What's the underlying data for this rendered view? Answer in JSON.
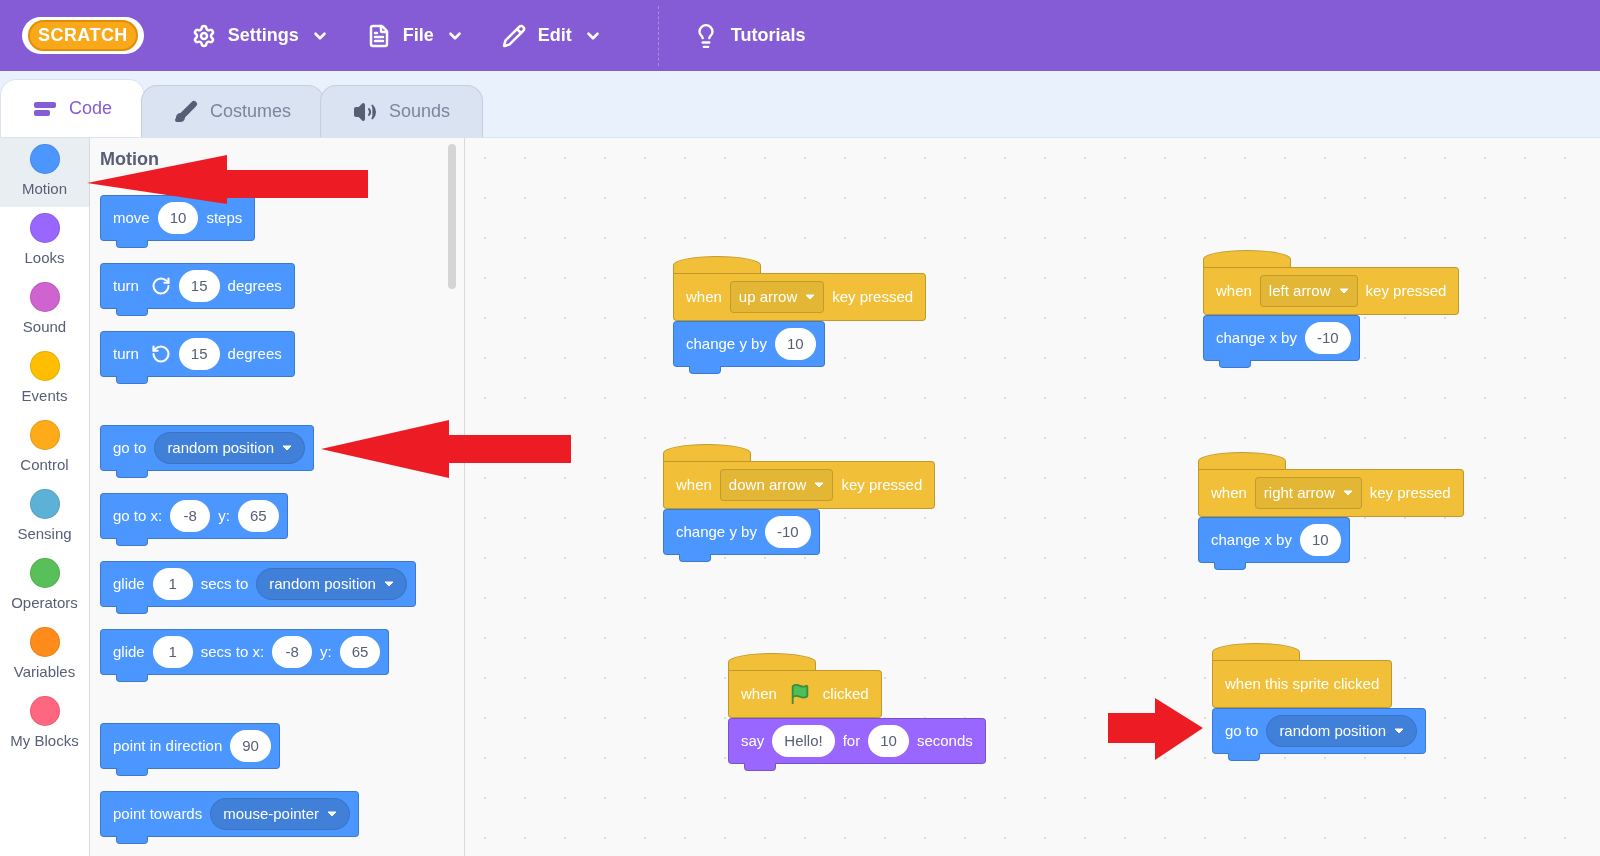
{
  "menu_bar": {
    "logo": "SCRATCH",
    "items": [
      {
        "label": "Settings",
        "kind": "gear"
      },
      {
        "label": "File",
        "kind": "file"
      },
      {
        "label": "Edit",
        "kind": "pencil"
      }
    ],
    "tutorials": "Tutorials"
  },
  "tabs": [
    {
      "label": "Code",
      "kind": "code",
      "selected": true
    },
    {
      "label": "Costumes",
      "kind": "brush",
      "selected": false
    },
    {
      "label": "Sounds",
      "kind": "speaker",
      "selected": false
    }
  ],
  "categories": [
    {
      "label": "Motion",
      "color": "#4c97ff",
      "selected": true
    },
    {
      "label": "Looks",
      "color": "#9966ff",
      "selected": false
    },
    {
      "label": "Sound",
      "color": "#cf63cf",
      "selected": false
    },
    {
      "label": "Events",
      "color": "#ffbf00",
      "selected": false
    },
    {
      "label": "Control",
      "color": "#ffab19",
      "selected": false
    },
    {
      "label": "Sensing",
      "color": "#5cb1d6",
      "selected": false
    },
    {
      "label": "Operators",
      "color": "#59c059",
      "selected": false
    },
    {
      "label": "Variables",
      "color": "#ff8c1a",
      "selected": false
    },
    {
      "label": "My Blocks",
      "color": "#ff6680",
      "selected": false
    }
  ],
  "palette": {
    "title": "Motion",
    "groups": [
      [
        {
          "color": "#4c97ff",
          "kind": "stack",
          "parts": [
            {
              "kind": "text",
              "text": "move"
            },
            {
              "kind": "number",
              "text": "10"
            },
            {
              "kind": "text",
              "text": "steps"
            }
          ]
        },
        {
          "color": "#4c97ff",
          "kind": "stack",
          "parts": [
            {
              "kind": "text",
              "text": "turn"
            },
            {
              "kind": "cw"
            },
            {
              "kind": "number",
              "text": "15"
            },
            {
              "kind": "text",
              "text": "degrees"
            }
          ]
        },
        {
          "color": "#4c97ff",
          "kind": "stack",
          "parts": [
            {
              "kind": "text",
              "text": "turn"
            },
            {
              "kind": "ccw"
            },
            {
              "kind": "number",
              "text": "15"
            },
            {
              "kind": "text",
              "text": "degrees"
            }
          ]
        }
      ],
      [
        {
          "color": "#4c97ff",
          "kind": "stack",
          "parts": [
            {
              "kind": "text",
              "text": "go to"
            },
            {
              "kind": "dropdown",
              "text": "random position"
            }
          ]
        },
        {
          "color": "#4c97ff",
          "kind": "stack",
          "parts": [
            {
              "kind": "text",
              "text": "go to x:"
            },
            {
              "kind": "number",
              "text": "-8"
            },
            {
              "kind": "text",
              "text": "y:"
            },
            {
              "kind": "number",
              "text": "65"
            }
          ]
        },
        {
          "color": "#4c97ff",
          "kind": "stack",
          "parts": [
            {
              "kind": "text",
              "text": "glide"
            },
            {
              "kind": "number",
              "text": "1"
            },
            {
              "kind": "text",
              "text": "secs to"
            },
            {
              "kind": "dropdown",
              "text": "random position"
            }
          ]
        },
        {
          "color": "#4c97ff",
          "kind": "stack",
          "parts": [
            {
              "kind": "text",
              "text": "glide"
            },
            {
              "kind": "number",
              "text": "1"
            },
            {
              "kind": "text",
              "text": "secs to x:"
            },
            {
              "kind": "number",
              "text": "-8"
            },
            {
              "kind": "text",
              "text": "y:"
            },
            {
              "kind": "number",
              "text": "65"
            }
          ]
        }
      ],
      [
        {
          "color": "#4c97ff",
          "kind": "stack",
          "parts": [
            {
              "kind": "text",
              "text": "point in direction"
            },
            {
              "kind": "number",
              "text": "90"
            }
          ]
        },
        {
          "color": "#4c97ff",
          "kind": "stack",
          "parts": [
            {
              "kind": "text",
              "text": "point towards"
            },
            {
              "kind": "dropdown",
              "text": "mouse-pointer"
            }
          ]
        }
      ]
    ]
  },
  "scripts": [
    [
      {
        "color": "#f1c038",
        "kind": "hat",
        "parts": [
          {
            "kind": "text",
            "text": "when"
          },
          {
            "kind": "menu",
            "text": "up arrow"
          },
          {
            "kind": "text",
            "text": "key pressed"
          }
        ]
      },
      {
        "color": "#4c97ff",
        "kind": "stack",
        "parts": [
          {
            "kind": "text",
            "text": "change y by"
          },
          {
            "kind": "number",
            "text": "10"
          }
        ]
      }
    ],
    [
      {
        "color": "#f1c038",
        "kind": "hat",
        "parts": [
          {
            "kind": "text",
            "text": "when"
          },
          {
            "kind": "menu",
            "text": "left arrow"
          },
          {
            "kind": "text",
            "text": "key pressed"
          }
        ]
      },
      {
        "color": "#4c97ff",
        "kind": "stack",
        "parts": [
          {
            "kind": "text",
            "text": "change x by"
          },
          {
            "kind": "number",
            "text": "-10"
          }
        ]
      }
    ],
    [
      {
        "color": "#f1c038",
        "kind": "hat",
        "parts": [
          {
            "kind": "text",
            "text": "when"
          },
          {
            "kind": "menu",
            "text": "down arrow"
          },
          {
            "kind": "text",
            "text": "key pressed"
          }
        ]
      },
      {
        "color": "#4c97ff",
        "kind": "stack",
        "parts": [
          {
            "kind": "text",
            "text": "change y by"
          },
          {
            "kind": "number",
            "text": "-10"
          }
        ]
      }
    ],
    [
      {
        "color": "#f1c038",
        "kind": "hat",
        "parts": [
          {
            "kind": "text",
            "text": "when"
          },
          {
            "kind": "menu",
            "text": "right arrow"
          },
          {
            "kind": "text",
            "text": "key pressed"
          }
        ]
      },
      {
        "color": "#4c97ff",
        "kind": "stack",
        "parts": [
          {
            "kind": "text",
            "text": "change x by"
          },
          {
            "kind": "number",
            "text": "10"
          }
        ]
      }
    ],
    [
      {
        "color": "#f1c038",
        "kind": "hat",
        "parts": [
          {
            "kind": "text",
            "text": "when"
          },
          {
            "kind": "flag"
          },
          {
            "kind": "text",
            "text": "clicked"
          }
        ]
      },
      {
        "color": "#9966ff",
        "kind": "stack",
        "parts": [
          {
            "kind": "text",
            "text": "say"
          },
          {
            "kind": "number",
            "text": "Hello!"
          },
          {
            "kind": "text",
            "text": "for"
          },
          {
            "kind": "number",
            "text": "10"
          },
          {
            "kind": "text",
            "text": "seconds"
          }
        ]
      }
    ],
    [
      {
        "color": "#f1c038",
        "kind": "hat",
        "parts": [
          {
            "kind": "text",
            "text": "when this sprite clicked"
          }
        ]
      },
      {
        "color": "#4c97ff",
        "kind": "stack",
        "parts": [
          {
            "kind": "text",
            "text": "go to"
          },
          {
            "kind": "dropdown",
            "text": "random position"
          }
        ]
      }
    ]
  ]
}
